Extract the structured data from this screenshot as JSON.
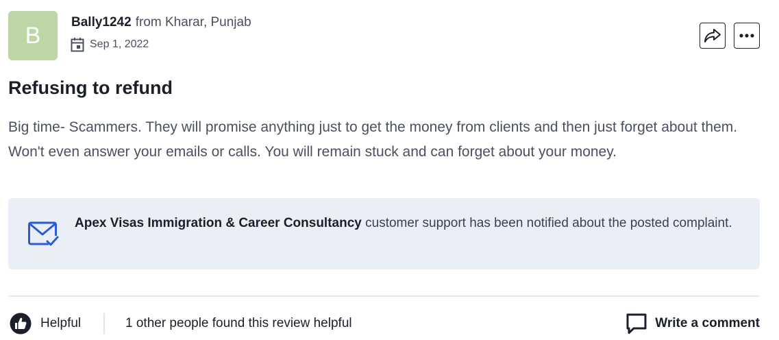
{
  "author": {
    "avatar_initial": "B",
    "name": "Bally1242",
    "location": "from Kharar, Punjab",
    "date": "Sep 1, 2022",
    "avatar_color": "#bcd7a5"
  },
  "actions": {
    "share_icon": "share-arrow-icon",
    "more_icon": "more-dots-icon"
  },
  "review": {
    "title": "Refusing to refund",
    "body": "Big time- Scammers. They will promise anything just to get the money from clients and then just forget about them. Won't even answer your emails or calls. You will remain stuck and can forget about your money."
  },
  "notice": {
    "company": "Apex Visas Immigration & Career Consultancy",
    "message": "customer support has been notified about the posted complaint.",
    "icon": "mail-check-icon",
    "background": "#eaeff7",
    "icon_color": "#2a5bd7"
  },
  "footer": {
    "helpful_label": "Helpful",
    "helpful_count_text": "1 other people found this review helpful",
    "comment_label": "Write a comment"
  }
}
